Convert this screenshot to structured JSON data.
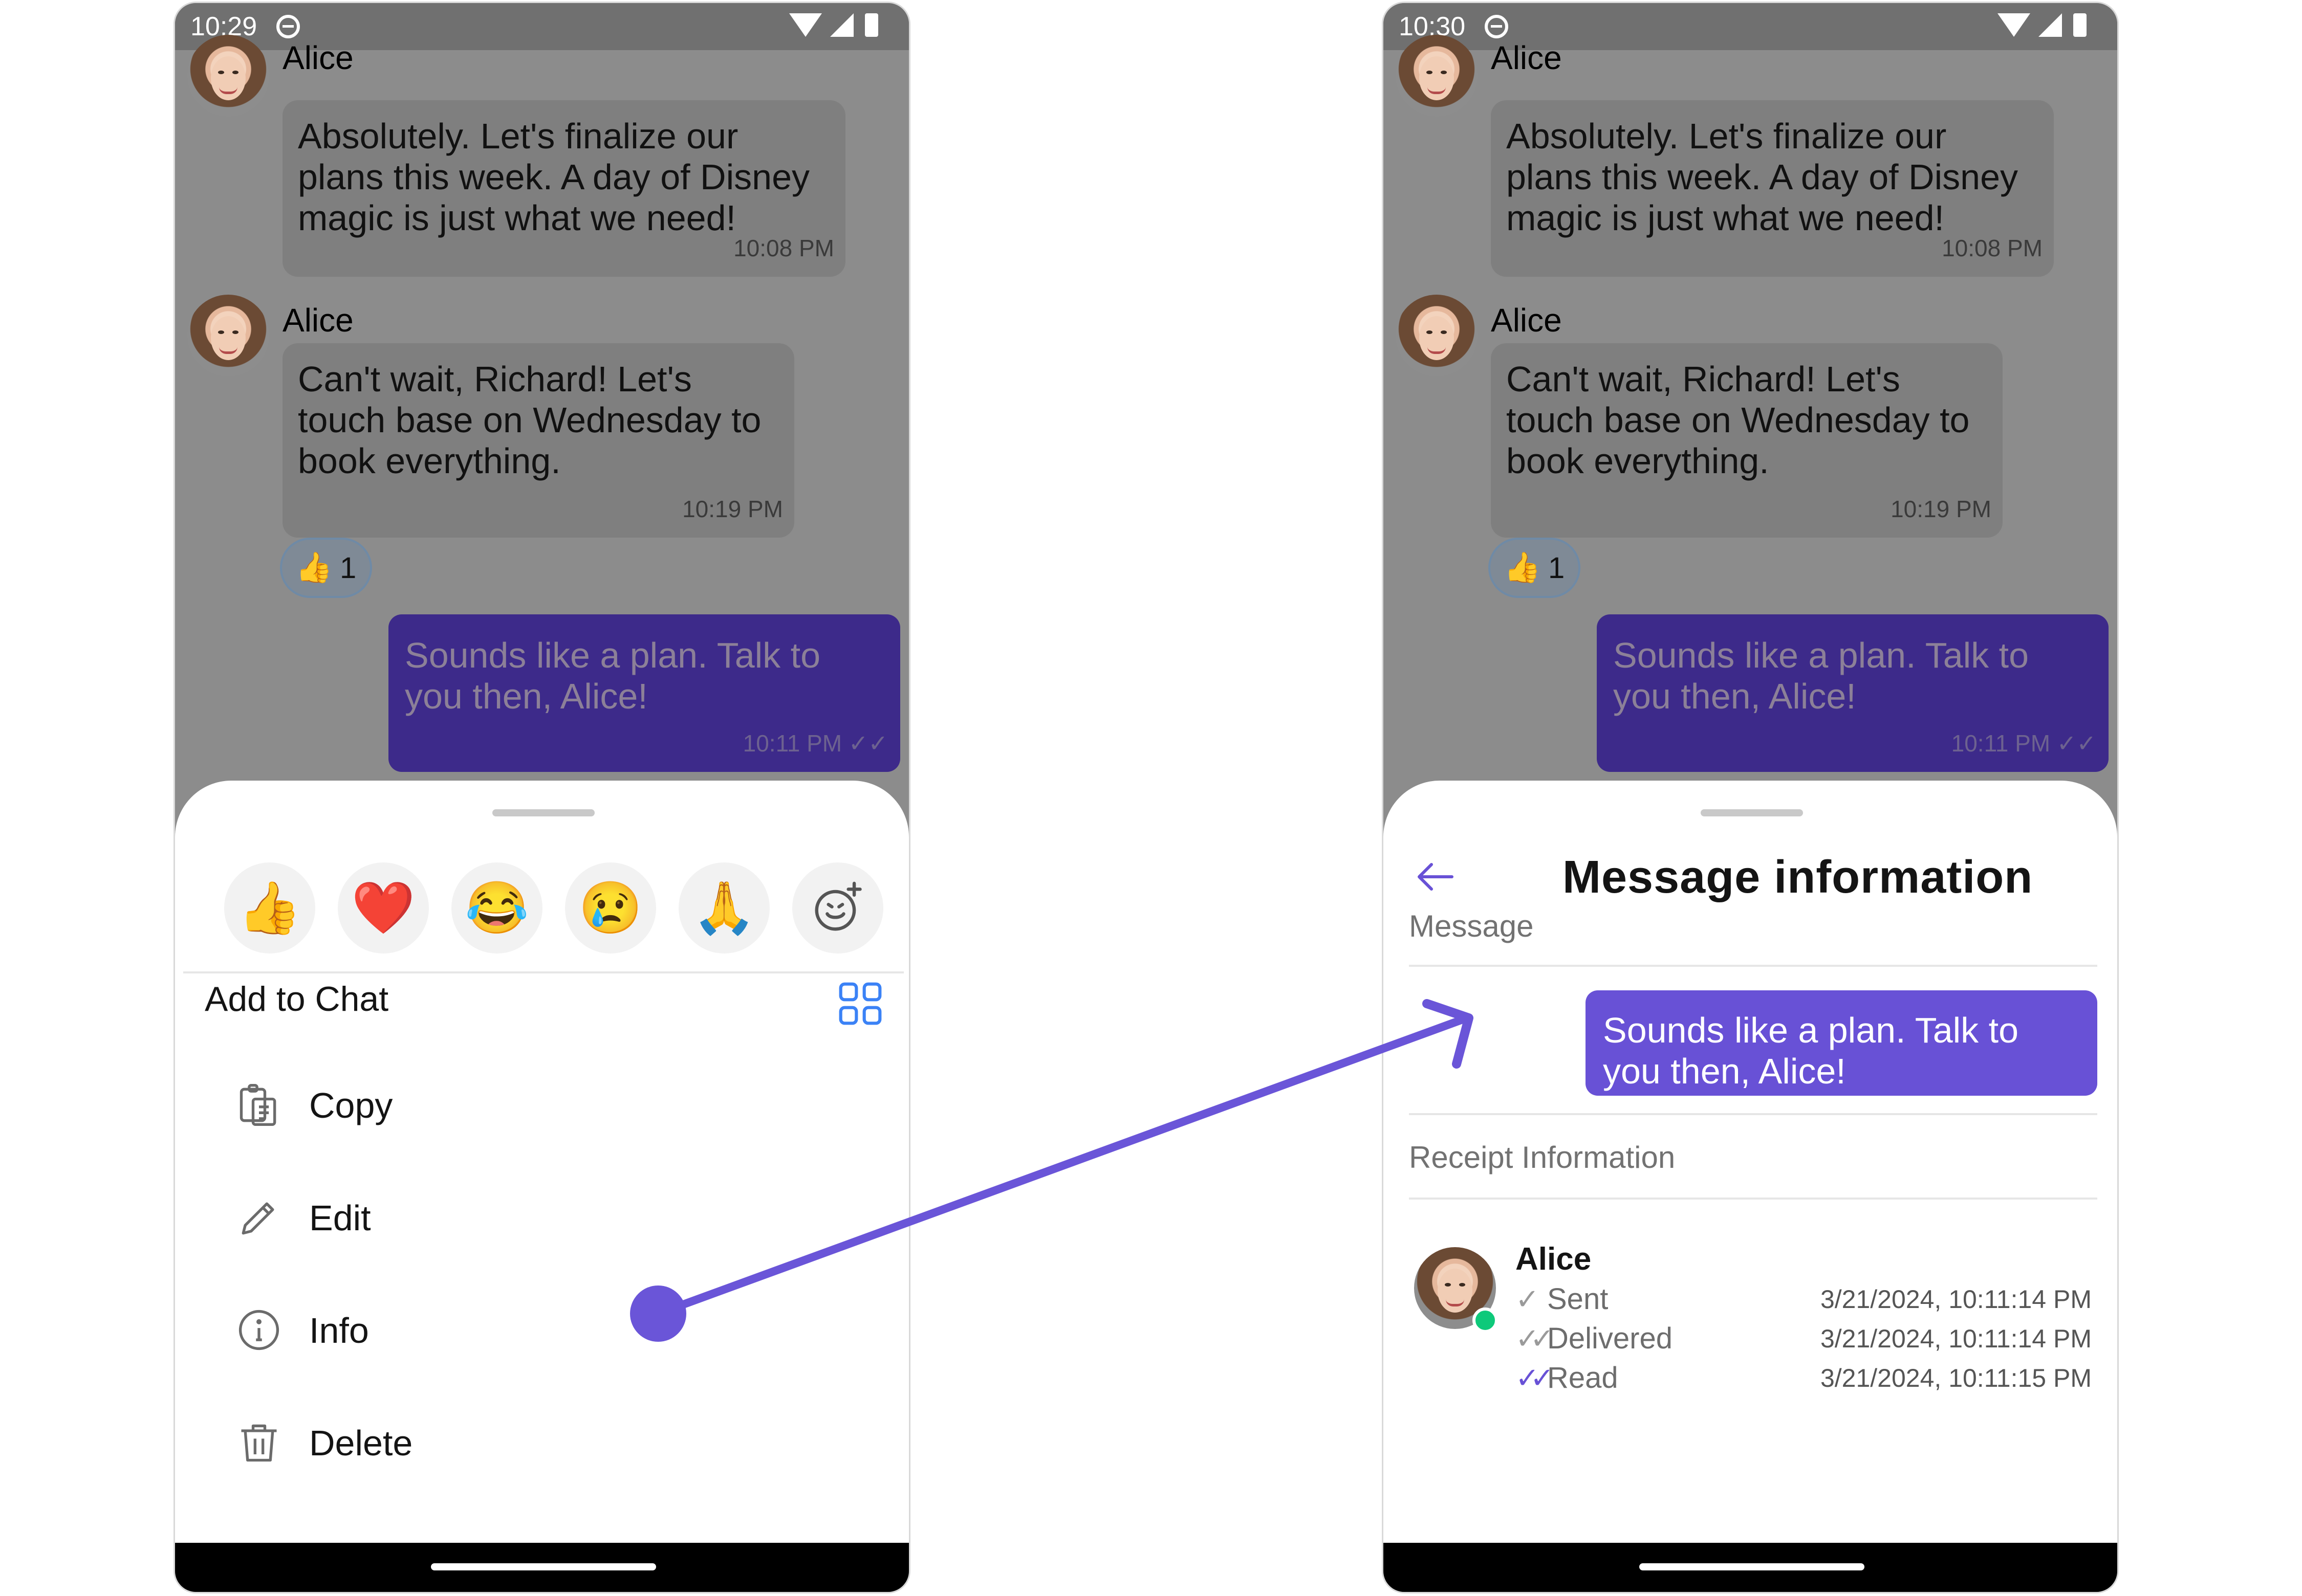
{
  "colors": {
    "accent": "#6851D6",
    "arrow": "#6A55D8",
    "outgoing_bubble_dimmed": "#3D2A8A",
    "online_dot": "#0EC97A",
    "reaction_border": "#6F8AA6"
  },
  "left_screen": {
    "status_bar": {
      "time": "10:29"
    },
    "messages": [
      {
        "sender": "Alice",
        "text": "Absolutely. Let's finalize our plans this week. A day of Disney magic is just what we need!",
        "time": "10:08 PM"
      },
      {
        "sender": "Alice",
        "text": "Can't wait, Richard! Let's touch base on Wednesday to book everything.",
        "time": "10:19 PM",
        "reaction": {
          "emoji": "👍",
          "count": "1"
        }
      },
      {
        "sender": "",
        "text": "Sounds like a plan. Talk to you then, Alice!",
        "time": "10:11 PM",
        "receipt_icon": "double-check-icon"
      }
    ],
    "reactions_bar": [
      {
        "emoji": "👍",
        "icon": "thumbs-up-icon"
      },
      {
        "emoji": "❤️",
        "icon": "heart-icon"
      },
      {
        "emoji": "😂",
        "icon": "laughing-icon"
      },
      {
        "emoji": "😢",
        "icon": "crying-icon"
      },
      {
        "emoji": "🙏",
        "icon": "praying-hands-icon"
      },
      {
        "emoji": "",
        "icon": "add-reaction-icon"
      }
    ],
    "sheet_title": "Add to Chat",
    "menu": [
      {
        "label": "Copy",
        "icon": "copy-icon"
      },
      {
        "label": "Edit",
        "icon": "pencil-icon"
      },
      {
        "label": "Info",
        "icon": "info-icon"
      },
      {
        "label": "Delete",
        "icon": "trash-icon"
      }
    ]
  },
  "right_screen": {
    "status_bar": {
      "time": "10:30"
    },
    "messages": [
      {
        "sender": "Alice",
        "text": "Absolutely. Let's finalize our plans this week. A day of Disney magic is just what we need!",
        "time": "10:08 PM"
      },
      {
        "sender": "Alice",
        "text": "Can't wait, Richard! Let's touch base on Wednesday to book everything.",
        "time": "10:19 PM",
        "reaction": {
          "emoji": "👍",
          "count": "1"
        }
      },
      {
        "sender": "",
        "text": "Sounds like a plan. Talk to you then, Alice!",
        "time": "10:11 PM",
        "receipt_icon": "double-check-icon"
      }
    ],
    "info_sheet": {
      "title": "Message information",
      "message_label": "Message",
      "message_text": "Sounds like a plan. Talk to you then, Alice!",
      "receipt_label": "Receipt Information",
      "receipt": {
        "name": "Alice",
        "rows": [
          {
            "status": "Sent",
            "tick": "✓",
            "date": "3/21/2024, 10:11:14 PM"
          },
          {
            "status": "Delivered",
            "tick": "✓✓",
            "date": "3/21/2024, 10:11:14 PM"
          },
          {
            "status": "Read",
            "tick": "✓✓",
            "date": "3/21/2024, 10:11:15 PM"
          }
        ]
      }
    }
  }
}
